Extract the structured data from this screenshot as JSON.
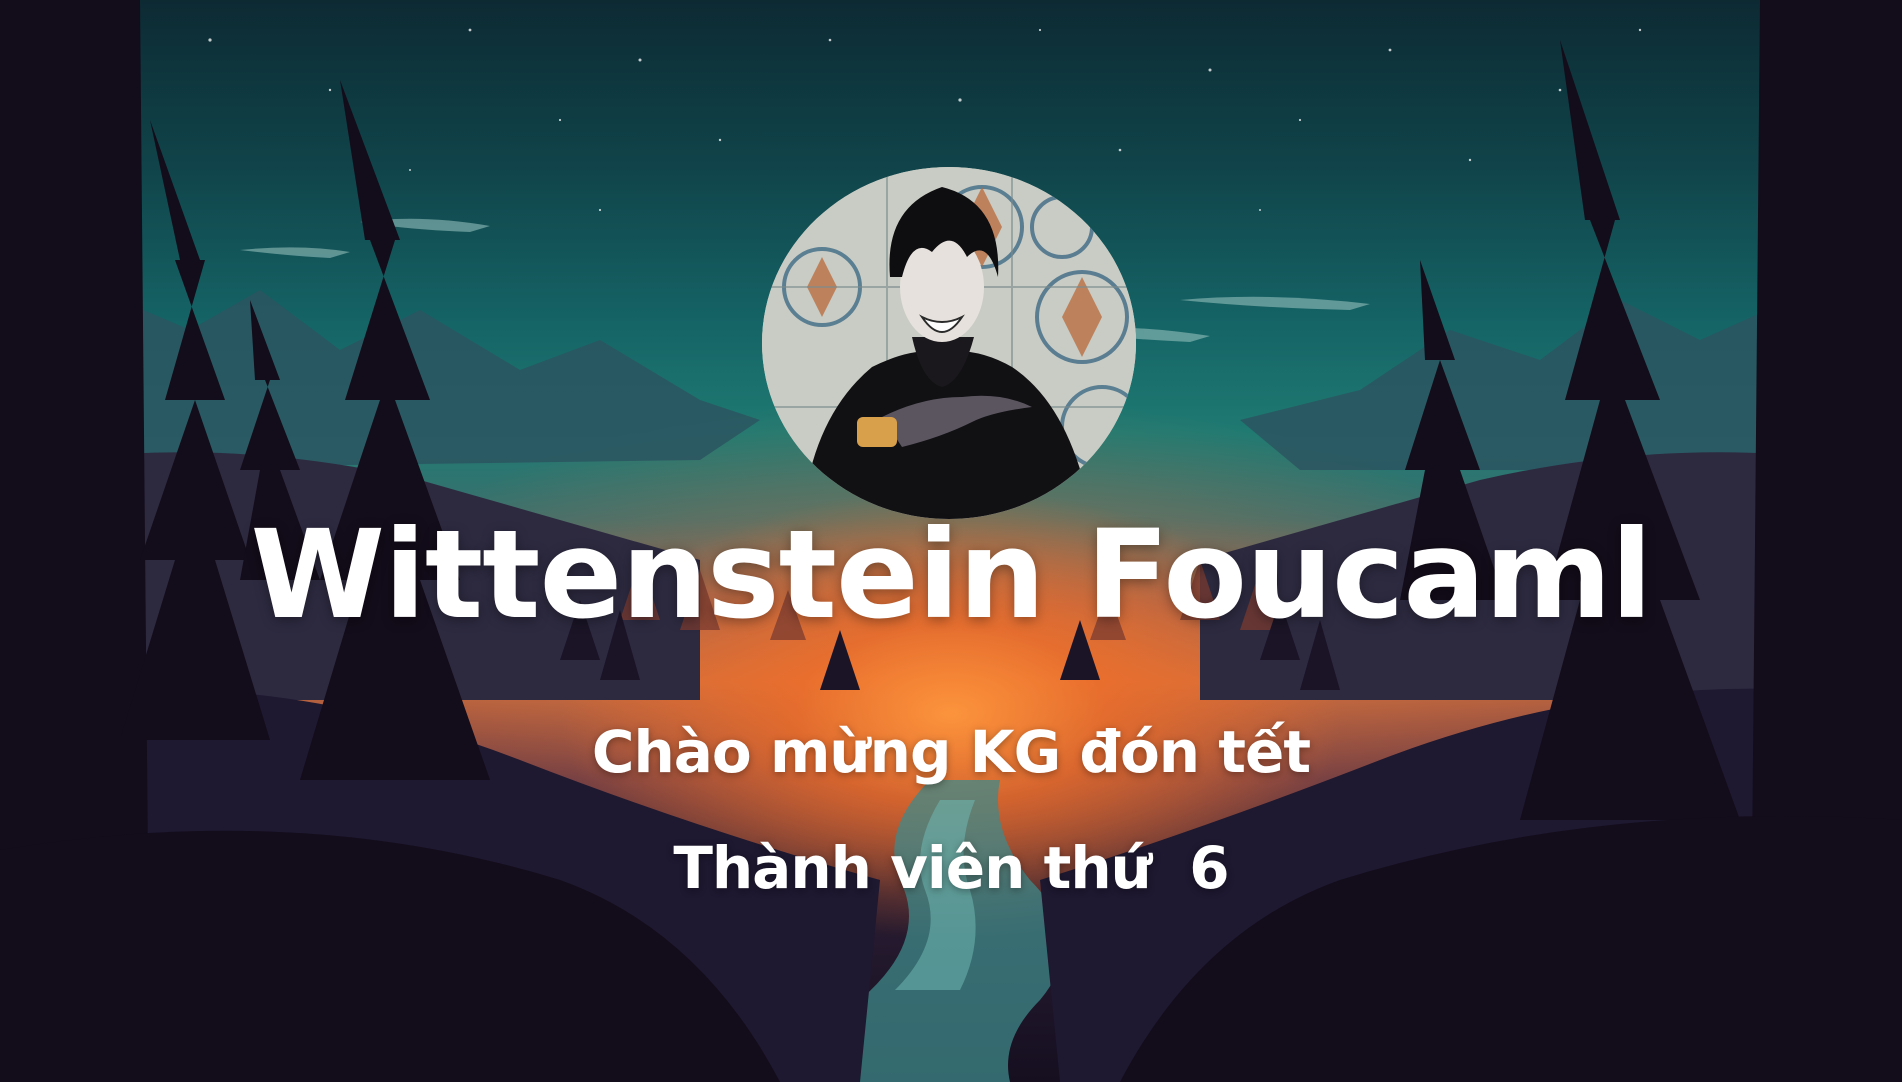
{
  "card": {
    "display_name": "Wittenstein Foucaml",
    "greeting": "Chào mừng KG đón tết",
    "member_text": "Thành viên thứ  6"
  },
  "colors": {
    "text": "#ffffff",
    "sky_teal": "#1f7a72",
    "sunset_orange": "#f08a3c",
    "forest_dark": "#120c1c"
  },
  "icons": {
    "avatar": "avatar-portrait"
  }
}
